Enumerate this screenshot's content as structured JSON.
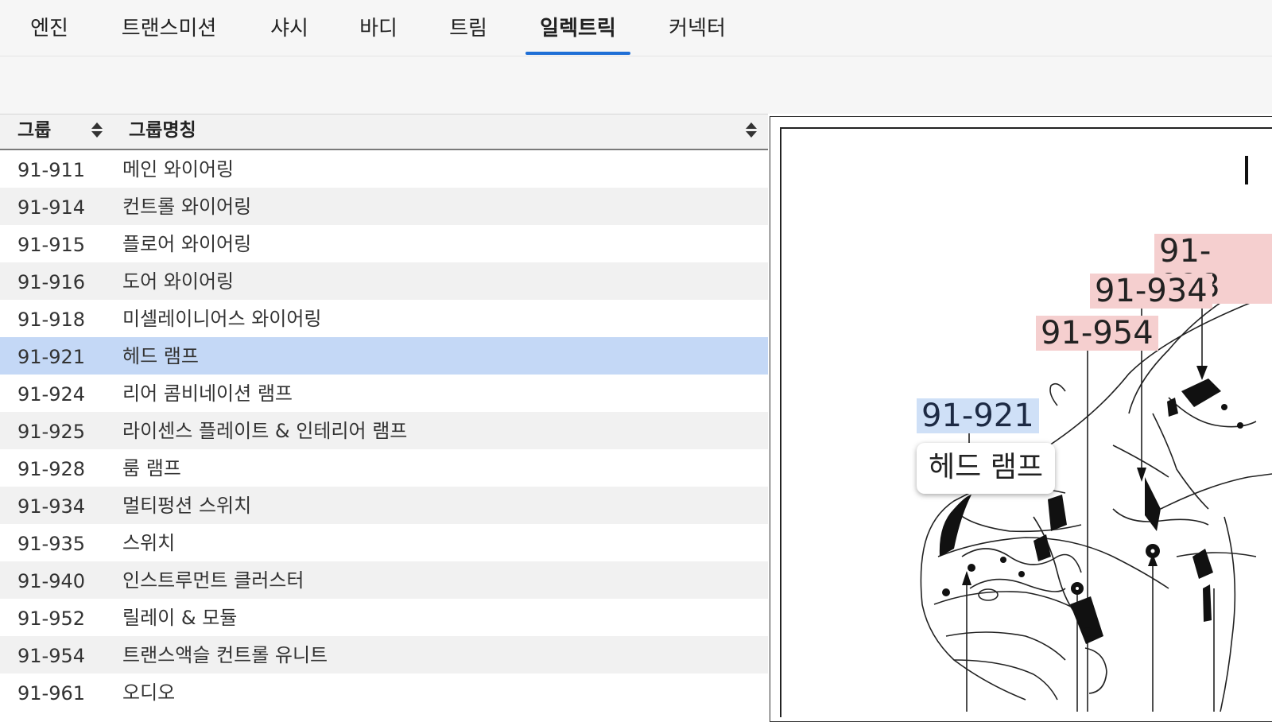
{
  "tabs": [
    {
      "label": "엔진",
      "active": false
    },
    {
      "label": "트랜스미션",
      "active": false
    },
    {
      "label": "샤시",
      "active": false
    },
    {
      "label": "바디",
      "active": false
    },
    {
      "label": "트림",
      "active": false
    },
    {
      "label": "일렉트릭",
      "active": true
    },
    {
      "label": "커넥터",
      "active": false
    }
  ],
  "table": {
    "headers": {
      "group": "그룹",
      "group_name": "그룹명칭"
    },
    "rows": [
      {
        "code": "91-911",
        "name": "메인 와이어링"
      },
      {
        "code": "91-914",
        "name": "컨트롤 와이어링"
      },
      {
        "code": "91-915",
        "name": "플로어 와이어링"
      },
      {
        "code": "91-916",
        "name": "도어 와이어링"
      },
      {
        "code": "91-918",
        "name": "미셀레이니어스 와이어링"
      },
      {
        "code": "91-921",
        "name": "헤드 램프",
        "selected": true
      },
      {
        "code": "91-924",
        "name": "리어 콤비네이션 램프"
      },
      {
        "code": "91-925",
        "name": "라이센스 플레이트 & 인테리어 램프"
      },
      {
        "code": "91-928",
        "name": "룸 램프"
      },
      {
        "code": "91-934",
        "name": "멀티펑션 스위치"
      },
      {
        "code": "91-935",
        "name": "스위치"
      },
      {
        "code": "91-940",
        "name": "인스트루먼트 클러스터"
      },
      {
        "code": "91-952",
        "name": "릴레이 & 모듈"
      },
      {
        "code": "91-954",
        "name": "트랜스액슬 컨트롤 유니트"
      },
      {
        "code": "91-961",
        "name": "오디오"
      }
    ]
  },
  "diagram": {
    "callouts": [
      {
        "code": "91-928",
        "highlight": "red"
      },
      {
        "code": "91-934",
        "highlight": "red"
      },
      {
        "code": "91-954",
        "highlight": "red"
      },
      {
        "code": "91-921",
        "highlight": "blue"
      }
    ],
    "tooltip": "헤드 램프"
  },
  "colors": {
    "accent": "#1f6fd6",
    "selected_row": "#c4d8f6",
    "callout_red": "#f5cfcf",
    "callout_blue": "#cfe0f7"
  }
}
